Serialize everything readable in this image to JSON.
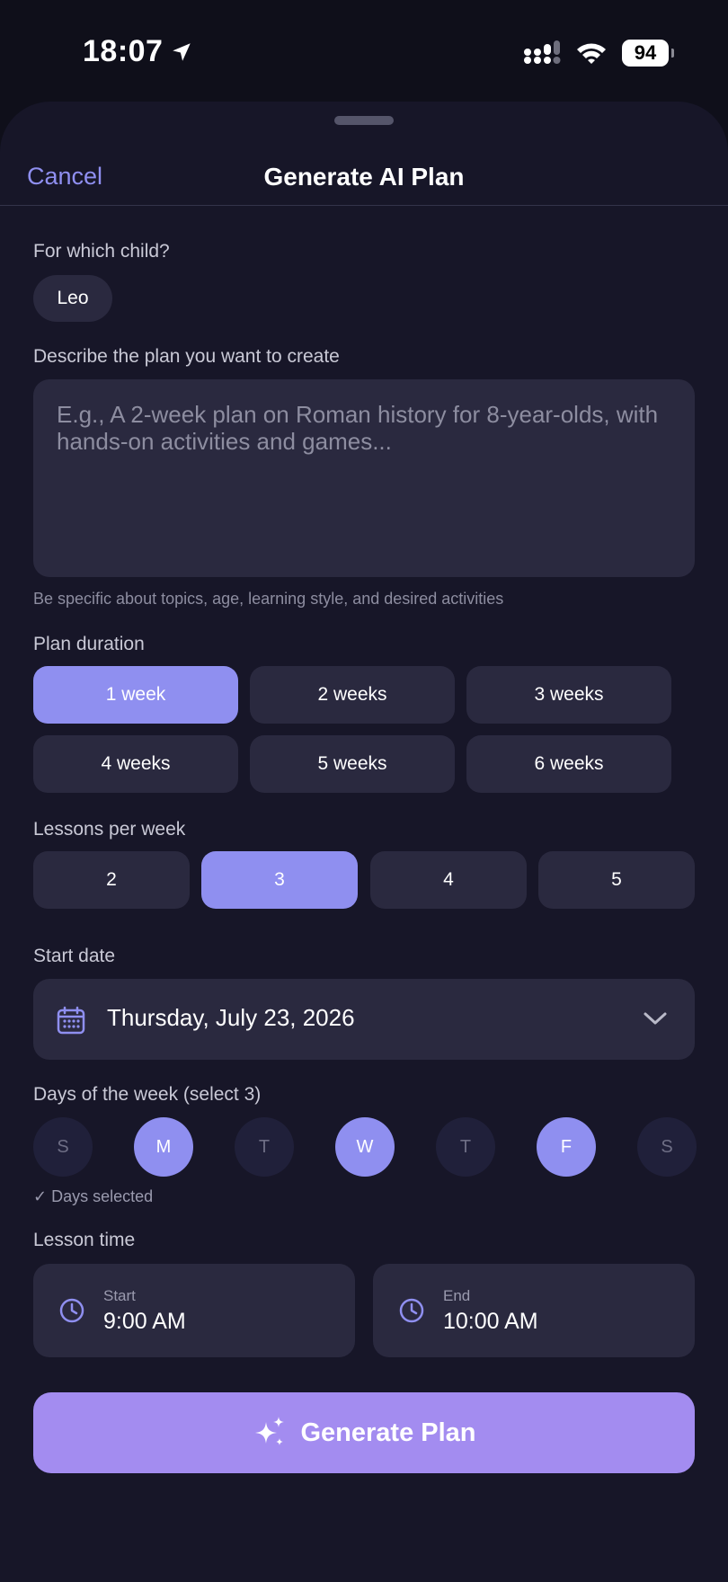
{
  "status_bar": {
    "time": "18:07",
    "battery": "94",
    "icons": [
      "location-arrow-icon",
      "signal-icon",
      "wifi-icon",
      "battery-icon"
    ]
  },
  "nav": {
    "cancel_label": "Cancel",
    "title": "Generate AI Plan"
  },
  "child": {
    "label": "For which child?",
    "selected": "Leo"
  },
  "description": {
    "label": "Describe the plan you want to create",
    "placeholder": "E.g., A 2-week plan on Roman history for 8-year-olds, with hands-on activities and games...",
    "hint": "Be specific about topics, age, learning style, and desired activities"
  },
  "duration": {
    "label": "Plan duration",
    "options": [
      "1 week",
      "2 weeks",
      "3 weeks",
      "4 weeks",
      "5 weeks",
      "6 weeks"
    ],
    "selected": "1 week"
  },
  "lessons": {
    "label": "Lessons per week",
    "options": [
      "2",
      "3",
      "4",
      "5"
    ],
    "selected": "3"
  },
  "start_date": {
    "label": "Start date",
    "value": "Thursday, July 23, 2026"
  },
  "days": {
    "label": "Days of the week (select 3)",
    "items": [
      "S",
      "M",
      "T",
      "W",
      "T",
      "F",
      "S"
    ],
    "selected": [
      "M",
      "W",
      "F"
    ],
    "status": "✓ Days selected"
  },
  "lesson_time": {
    "label": "Lesson time",
    "start_label": "Start",
    "start_value": "9:00 AM",
    "end_label": "End",
    "end_value": "10:00 AM"
  },
  "generate_label": "Generate Plan",
  "colors": {
    "background": "#0f0f1a",
    "sheet": "#171628",
    "card": "#2a293f",
    "accent": "#8f8ff0",
    "generate": "#a38cf0"
  }
}
